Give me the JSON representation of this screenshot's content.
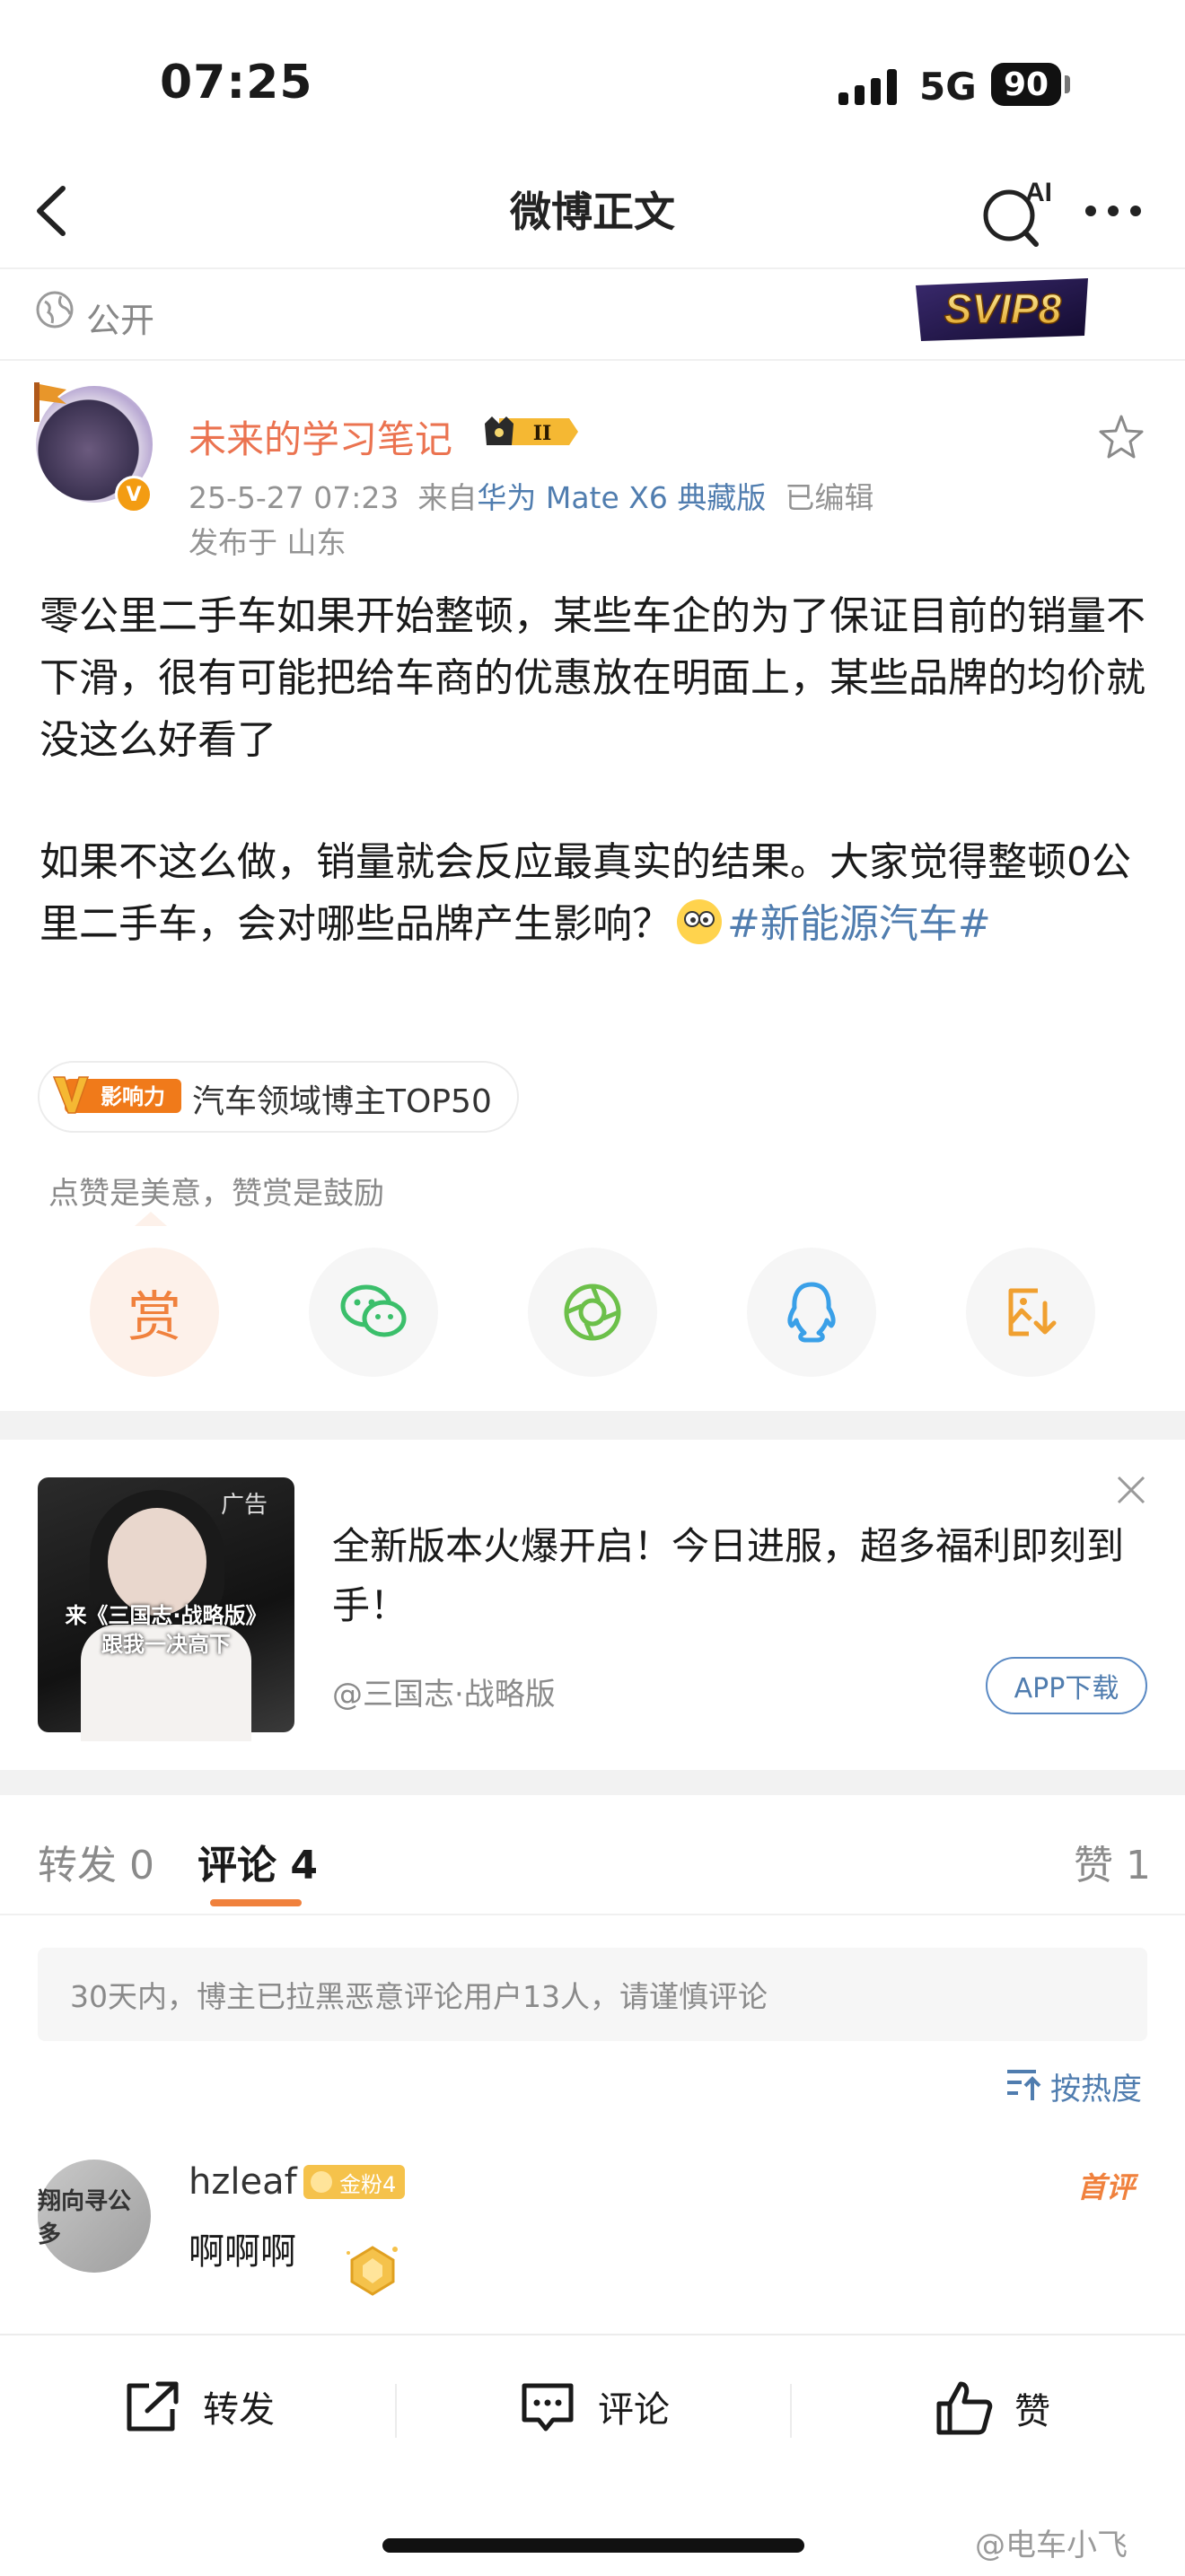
{
  "status_bar": {
    "time": "07:25",
    "network": "5G",
    "battery": "90"
  },
  "nav": {
    "title": "微博正文",
    "ai_label": "AI"
  },
  "visibility": {
    "label": "公开",
    "svip_badge": "SVIP8"
  },
  "author": {
    "name": "未来的学习笔记",
    "level_badge": "II",
    "timestamp": "25-5-27 07:23",
    "from_prefix": "来自",
    "device": "华为 Mate X6 典藏版",
    "edited": "已编辑",
    "location": "发布于 山东"
  },
  "post": {
    "paragraph1": "零公里二手车如果开始整顿，某些车企的为了保证目前的销量不下滑，很有可能把给车商的优惠放在明面上，某些品牌的均价就没这么好看了",
    "paragraph2_text": "如果不这么做，销量就会反应最真实的结果。大家觉得整顿0公里二手车，会对哪些品牌产生影响？",
    "hashtag": "#新能源汽车#"
  },
  "influence_badge": {
    "icon_text": "影响力",
    "text": "汽车领域博主TOP50"
  },
  "reward_tip": "点赞是美意，赞赏是鼓励",
  "share": {
    "reward_label": "赏"
  },
  "ad": {
    "tag": "广告",
    "image_caption_line1": "来《三国志·战略版》",
    "image_caption_line2": "跟我一决高下",
    "title": "全新版本火爆开启！今日进服，超多福利即刻到手！",
    "source": "@三国志·战略版",
    "button": "APP下载"
  },
  "tabs": {
    "repost": "转发 0",
    "comment": "评论 4",
    "like": "赞 1"
  },
  "notice": "30天内，博主已拉黑恶意评论用户13人，请谨慎评论",
  "sort": {
    "label": "按热度"
  },
  "comment": {
    "avatar_text": "翔向寻公多",
    "name": "hzleaf",
    "fan_badge": "金粉4",
    "text": "啊啊啊",
    "hot_label": "首评"
  },
  "bottom_bar": {
    "repost": "转发",
    "comment": "评论",
    "like": "赞"
  },
  "watermark": "@电车小飞",
  "colors": {
    "accent_orange": "#eb7350",
    "link_blue": "#507daf",
    "tab_underline": "#f0813d"
  }
}
